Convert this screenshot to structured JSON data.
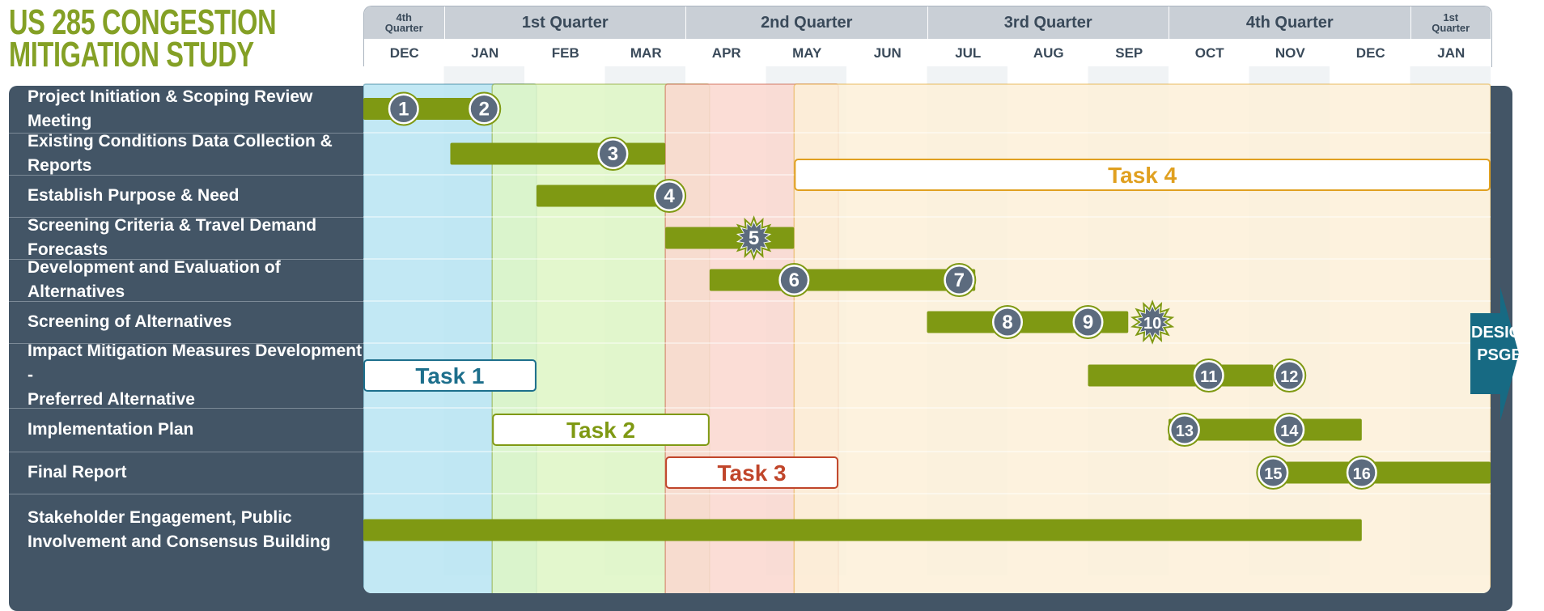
{
  "title": {
    "line1": "US 285 CONGESTION",
    "line2": "MITIGATION STUDY"
  },
  "colors": {
    "title": "#84a025",
    "panel": "#435566",
    "bar": "#7f9913",
    "milestone": "#5c6b7e",
    "task1": "#1d6f8c",
    "task2": "#7f9913",
    "task3": "#c0452a",
    "task4": "#e0a020",
    "design_arrow": "#176a83"
  },
  "header": {
    "quarters": [
      {
        "label_line1": "4th",
        "label_line2": "Quarter",
        "start": 0,
        "end": 1
      },
      {
        "label": "1st Quarter",
        "start": 1,
        "end": 4
      },
      {
        "label": "2nd Quarter",
        "start": 4,
        "end": 7
      },
      {
        "label": "3rd Quarter",
        "start": 7,
        "end": 10
      },
      {
        "label": "4th Quarter",
        "start": 10,
        "end": 13
      },
      {
        "label_line1": "1st",
        "label_line2": "Quarter",
        "start": 13,
        "end": 14
      }
    ],
    "months": [
      "DEC",
      "JAN",
      "FEB",
      "MAR",
      "APR",
      "MAY",
      "JUN",
      "JUL",
      "AUG",
      "SEP",
      "OCT",
      "NOV",
      "DEC",
      "JAN"
    ]
  },
  "chart_data": {
    "type": "gantt",
    "title": "US 285 CONGESTION MITIGATION STUDY",
    "x_axis": {
      "unit": "month",
      "months": [
        "DEC",
        "JAN",
        "FEB",
        "MAR",
        "APR",
        "MAY",
        "JUN",
        "JUL",
        "AUG",
        "SEP",
        "OCT",
        "NOV",
        "DEC",
        "JAN"
      ],
      "quarters": [
        "4th Quarter",
        "1st Quarter",
        "2nd Quarter",
        "3rd Quarter",
        "4th Quarter",
        "1st Quarter"
      ],
      "range": [
        0,
        14
      ]
    },
    "rows": [
      {
        "label_lines": [
          "Project Initiation & Scoping Review Meeting"
        ]
      },
      {
        "label_lines": [
          "Existing Conditions Data Collection & Reports"
        ]
      },
      {
        "label_lines": [
          "Establish Purpose & Need"
        ]
      },
      {
        "label_lines": [
          "Screening Criteria & Travel Demand Forecasts"
        ]
      },
      {
        "label_lines": [
          "Development and Evaluation of Alternatives"
        ]
      },
      {
        "label_lines": [
          "Screening of Alternatives"
        ]
      },
      {
        "label_lines": [
          "Impact Mitigation Measures Development -",
          "Preferred Alternative"
        ]
      },
      {
        "label_lines": [
          "Implementation Plan"
        ]
      },
      {
        "label_lines": [
          "Final Report"
        ]
      },
      {
        "label_lines": [
          "Stakeholder Engagement, Public",
          "Involvement and Consensus Building"
        ]
      }
    ],
    "phases": [
      {
        "label": "Task 1",
        "start": 0,
        "end": 2.15,
        "color": "#1d6f8c",
        "bg": "#b7e4f2",
        "label_row": 6
      },
      {
        "label": "Task 2",
        "start": 1.6,
        "end": 4.3,
        "color": "#7f9913",
        "bg": "#def6c4",
        "label_row": 7
      },
      {
        "label": "Task 3",
        "start": 3.75,
        "end": 5.9,
        "color": "#c0452a",
        "bg": "#fad7cf",
        "label_row": 8
      },
      {
        "label": "Task 4",
        "start": 5.35,
        "end": 14,
        "color": "#e0a020",
        "bg": "#fdf0d8",
        "label_row": 1.5
      }
    ],
    "bars": [
      {
        "row": 0,
        "start": 0,
        "end": 1.65
      },
      {
        "row": 1,
        "start": 1.08,
        "end": 3.75
      },
      {
        "row": 2,
        "start": 2.15,
        "end": 3.9
      },
      {
        "row": 3,
        "start": 3.75,
        "end": 5.35
      },
      {
        "row": 4,
        "start": 4.3,
        "end": 7.6
      },
      {
        "row": 5,
        "start": 7.0,
        "end": 9.5
      },
      {
        "row": 6,
        "start": 9.0,
        "end": 11.3
      },
      {
        "row": 7,
        "start": 10.0,
        "end": 12.4
      },
      {
        "row": 8,
        "start": 11.3,
        "end": 14
      },
      {
        "row": 9,
        "start": 0,
        "end": 12.4
      }
    ],
    "milestones": [
      {
        "id": "1",
        "row": 0,
        "x": 0.5,
        "shape": "circle"
      },
      {
        "id": "2",
        "row": 0,
        "x": 1.5,
        "shape": "circle"
      },
      {
        "id": "3",
        "row": 1,
        "x": 3.1,
        "shape": "circle"
      },
      {
        "id": "4",
        "row": 2,
        "x": 3.8,
        "shape": "circle"
      },
      {
        "id": "5",
        "row": 3,
        "x": 4.85,
        "shape": "starburst"
      },
      {
        "id": "6",
        "row": 4,
        "x": 5.35,
        "shape": "circle"
      },
      {
        "id": "7",
        "row": 4,
        "x": 7.4,
        "shape": "circle"
      },
      {
        "id": "8",
        "row": 5,
        "x": 8.0,
        "shape": "circle"
      },
      {
        "id": "9",
        "row": 5,
        "x": 9.0,
        "shape": "circle"
      },
      {
        "id": "10",
        "row": 5,
        "x": 9.8,
        "shape": "starburst"
      },
      {
        "id": "11",
        "row": 6,
        "x": 10.5,
        "shape": "circle"
      },
      {
        "id": "12",
        "row": 6,
        "x": 11.5,
        "shape": "circle"
      },
      {
        "id": "13",
        "row": 7,
        "x": 10.2,
        "shape": "circle"
      },
      {
        "id": "14",
        "row": 7,
        "x": 11.5,
        "shape": "circle"
      },
      {
        "id": "15",
        "row": 8,
        "x": 11.3,
        "shape": "circle"
      },
      {
        "id": "16",
        "row": 8,
        "x": 12.4,
        "shape": "circle"
      }
    ]
  },
  "design_arrow": {
    "line1": "DESIGN",
    "line2": "PSGE"
  }
}
